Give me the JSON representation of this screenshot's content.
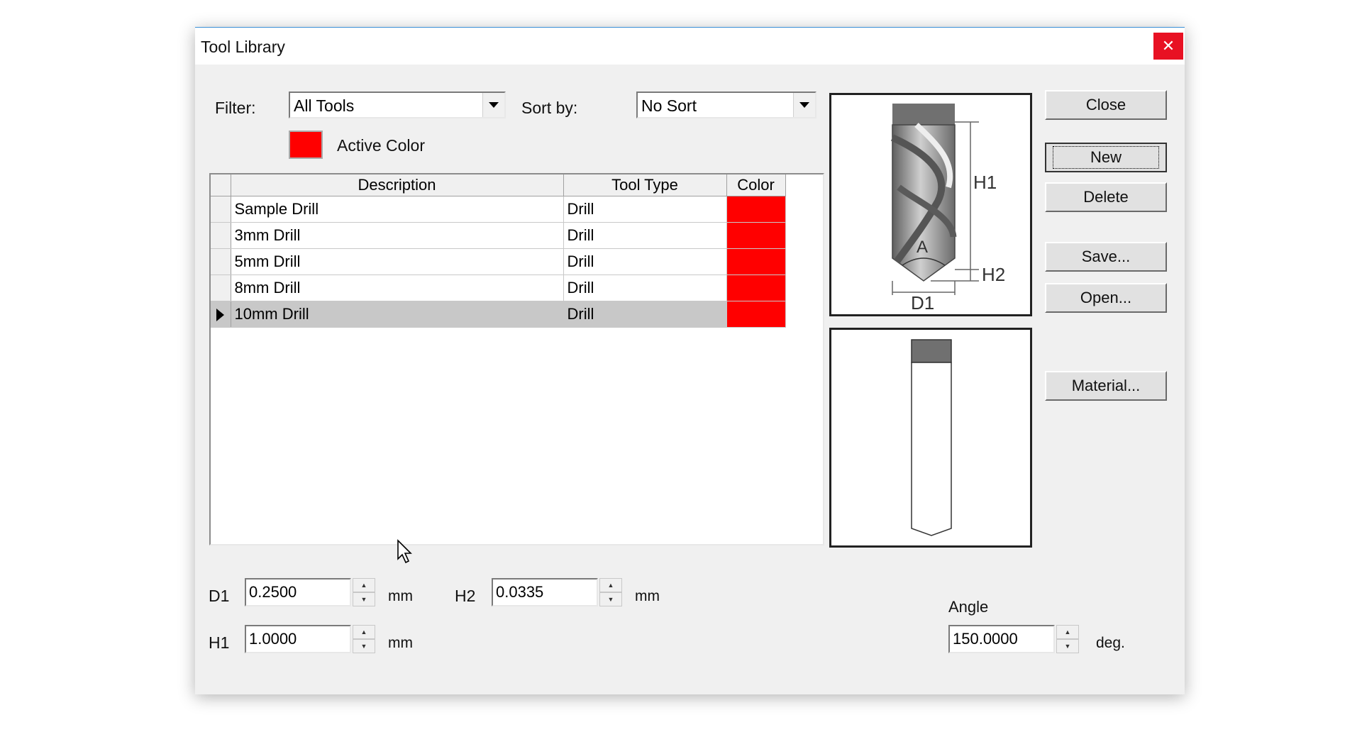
{
  "window": {
    "title": "Tool Library",
    "close_glyph": "✕"
  },
  "filter": {
    "label": "Filter:",
    "value": "All Tools"
  },
  "sort": {
    "label": "Sort by:",
    "value": "No Sort"
  },
  "active_color": {
    "label": "Active Color",
    "color": "#ff0000"
  },
  "table": {
    "columns": [
      "Description",
      "Tool Type",
      "Color"
    ],
    "rows": [
      {
        "description": "Sample Drill",
        "type": "Drill",
        "color": "#ff0000"
      },
      {
        "description": "3mm Drill",
        "type": "Drill",
        "color": "#ff0000"
      },
      {
        "description": "5mm Drill",
        "type": "Drill",
        "color": "#ff0000"
      },
      {
        "description": "8mm Drill",
        "type": "Drill",
        "color": "#ff0000"
      },
      {
        "description": "10mm Drill",
        "type": "Drill",
        "color": "#ff0000"
      }
    ],
    "selected_index": 4
  },
  "buttons": {
    "close": "Close",
    "new": "New",
    "delete": "Delete",
    "save": "Save...",
    "open": "Open...",
    "material": "Material..."
  },
  "diagram": {
    "h1": "H1",
    "h2": "H2",
    "d1": "D1",
    "a": "A"
  },
  "params": {
    "d1": {
      "label": "D1",
      "value": "0.2500",
      "unit": "mm"
    },
    "h2": {
      "label": "H2",
      "value": "0.0335",
      "unit": "mm"
    },
    "h1": {
      "label": "H1",
      "value": "1.0000",
      "unit": "mm"
    },
    "angle": {
      "label": "Angle",
      "value": "150.0000",
      "unit": "deg."
    }
  }
}
